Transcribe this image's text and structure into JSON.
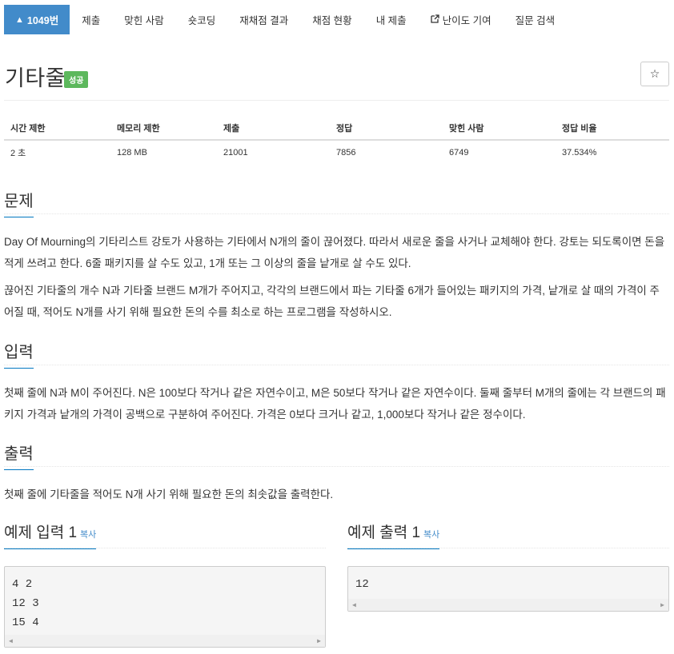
{
  "nav": {
    "problem_id": "1049번",
    "tabs": [
      "제출",
      "맞힌 사람",
      "숏코딩",
      "재채점 결과",
      "채점 현황",
      "내 제출",
      "난이도 기여",
      "질문 검색"
    ]
  },
  "problem": {
    "title": "기타줄",
    "status_badge": "성공",
    "star": "☆"
  },
  "info_table": {
    "headers": [
      "시간 제한",
      "메모리 제한",
      "제출",
      "정답",
      "맞힌 사람",
      "정답 비율"
    ],
    "values": [
      "2 초",
      "128 MB",
      "21001",
      "7856",
      "6749",
      "37.534%"
    ]
  },
  "sections": {
    "description": {
      "title": "문제",
      "p1": "Day Of Mourning의 기타리스트 강토가 사용하는 기타에서 N개의 줄이 끊어졌다. 따라서 새로운 줄을 사거나 교체해야 한다. 강토는 되도록이면 돈을 적게 쓰려고 한다. 6줄 패키지를 살 수도 있고, 1개 또는 그 이상의 줄을 낱개로 살 수도 있다.",
      "p2": "끊어진 기타줄의 개수 N과 기타줄 브랜드 M개가 주어지고, 각각의 브랜드에서 파는 기타줄 6개가 들어있는 패키지의 가격, 낱개로 살 때의 가격이 주어질 때, 적어도 N개를 사기 위해 필요한 돈의 수를 최소로 하는 프로그램을 작성하시오."
    },
    "input": {
      "title": "입력",
      "p1": "첫째 줄에 N과 M이 주어진다. N은 100보다 작거나 같은 자연수이고, M은 50보다 작거나 같은 자연수이다. 둘째 줄부터 M개의 줄에는 각 브랜드의 패키지 가격과 낱개의 가격이 공백으로 구분하여 주어진다. 가격은 0보다 크거나 같고, 1,000보다 작거나 같은 정수이다."
    },
    "output": {
      "title": "출력",
      "p1": "첫째 줄에 기타줄을 적어도 N개 사기 위해 필요한 돈의 최솟값을 출력한다."
    }
  },
  "examples": {
    "input_title": "예제 입력 1",
    "output_title": "예제 출력 1",
    "copy_label": "복사",
    "input_code": "4 2\n12 3\n15 4",
    "output_code": "12"
  },
  "colors": {
    "nav_active": "#428bca",
    "success_badge": "#5cb85c",
    "section_underline": "#0076c0"
  }
}
